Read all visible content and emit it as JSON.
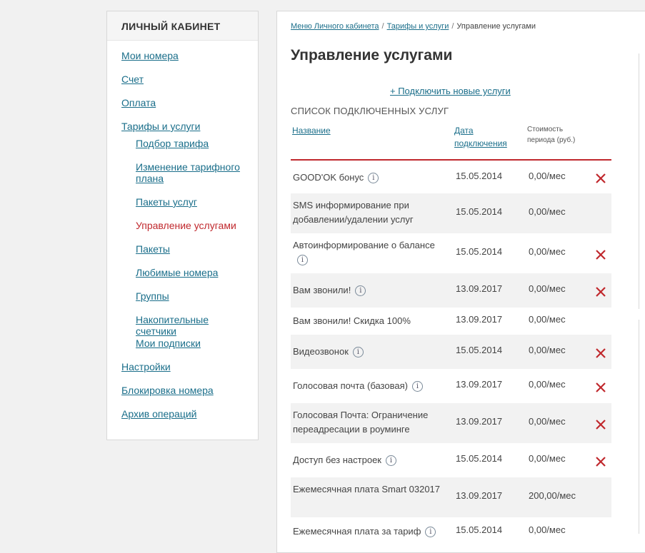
{
  "sidebar": {
    "title": "ЛИЧНЫЙ КАБИНЕТ",
    "items": [
      {
        "label": "Мои номера"
      },
      {
        "label": "Счет"
      },
      {
        "label": "Оплата"
      },
      {
        "label": "Тарифы и услуги"
      },
      {
        "label": "Настройки"
      },
      {
        "label": "Блокировка номера"
      },
      {
        "label": "Архив операций"
      }
    ],
    "subitems": [
      {
        "label": "Подбор тарифа"
      },
      {
        "label": "Изменение тарифного плана"
      },
      {
        "label": "Пакеты услуг"
      },
      {
        "label": "Управление услугами"
      },
      {
        "label": "Пакеты"
      },
      {
        "label": "Любимые номера"
      },
      {
        "label": "Группы"
      },
      {
        "label": "Накопительные счетчики"
      },
      {
        "label": "Мои подписки"
      }
    ],
    "active_color": "#c0282d",
    "link_color": "#1a6e8a"
  },
  "breadcrumb": {
    "items": [
      "Меню Личного кабинета",
      "Тарифы и услуги",
      "Управление услугами"
    ],
    "separator": "/"
  },
  "main": {
    "title": "Управление услугами",
    "add_link": "+ Подключить новые услуги",
    "list_caption": "СПИСОК ПОДКЛЮЧЕННЫХ УСЛУГ",
    "headers": {
      "name": "Название",
      "date_line1": "Дата",
      "date_line2": "подключения",
      "price_line1": "Стоимость",
      "price_line2": "периода (руб.)"
    },
    "rows": [
      {
        "name": "GOOD'OK бонус",
        "date": "15.05.2014",
        "price": "0,00/мес",
        "info": true,
        "removable": true
      },
      {
        "name": "SMS информирование при добавлении/удалении услуг",
        "date": "15.05.2014",
        "price": "0,00/мес",
        "info": false,
        "removable": false
      },
      {
        "name": "Автоинформирование о балансе",
        "date": "15.05.2014",
        "price": "0,00/мес",
        "info": true,
        "removable": true
      },
      {
        "name": "Вам звонили!",
        "date": "13.09.2017",
        "price": "0,00/мес",
        "info": true,
        "removable": true
      },
      {
        "name": "Вам звонили! Скидка 100%",
        "date": "13.09.2017",
        "price": "0,00/мес",
        "info": false,
        "removable": false
      },
      {
        "name": "Видеозвонок",
        "date": "15.05.2014",
        "price": "0,00/мес",
        "info": true,
        "removable": true
      },
      {
        "name": "Голосовая почта (базовая)",
        "date": "13.09.2017",
        "price": "0,00/мес",
        "info": true,
        "removable": true
      },
      {
        "name": "Голосовая Почта: Ограничение переадресации в роуминге",
        "date": "13.09.2017",
        "price": "0,00/мес",
        "info": false,
        "removable": true
      },
      {
        "name": "Доступ без настроек",
        "date": "15.05.2014",
        "price": "0,00/мес",
        "info": true,
        "removable": true
      },
      {
        "name": "Ежемесячная плата Smart 032017",
        "date": "13.09.2017",
        "price": "200,00/мес",
        "info": false,
        "removable": false
      },
      {
        "name": "Ежемесячная плата за тариф",
        "date": "15.05.2014",
        "price": "0,00/мес",
        "info": true,
        "removable": false
      }
    ],
    "info_glyph": "i",
    "delete_icon_color": "#c0282d"
  }
}
